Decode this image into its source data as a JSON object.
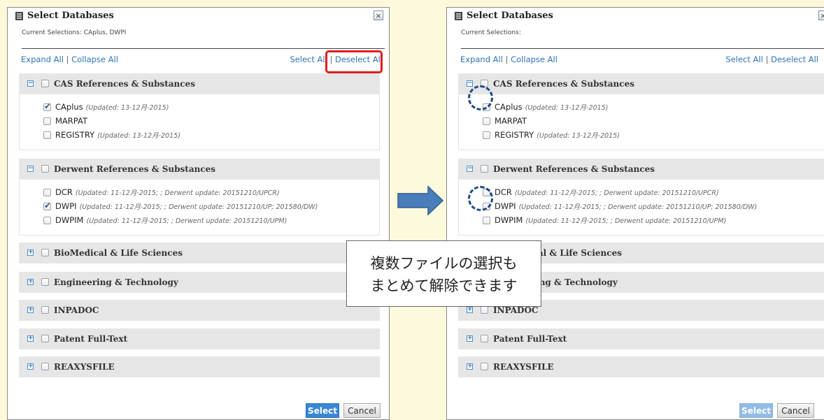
{
  "dialog": {
    "title": "Select Databases",
    "close_label": "×",
    "expand_all": "Expand All",
    "collapse_all": "Collapse All",
    "separator": "|",
    "select_all": "Select All",
    "deselect_all": "Deselect All",
    "select_button": "Select",
    "cancel_button": "Cancel"
  },
  "left": {
    "current_selections": "Current Selections: CAplus, DWPI",
    "sections": [
      {
        "toggle": "−",
        "label": "CAS References & Substances"
      },
      {
        "toggle": "−",
        "label": "Derwent References & Substances"
      },
      {
        "toggle": "+",
        "label": "BioMedical & Life Sciences"
      },
      {
        "toggle": "+",
        "label": "Engineering & Technology"
      },
      {
        "toggle": "+",
        "label": "INPADOC"
      },
      {
        "toggle": "+",
        "label": "Patent Full-Text"
      },
      {
        "toggle": "+",
        "label": "REAXYSFILE"
      }
    ],
    "cas_items": [
      {
        "name": "CAplus",
        "note": "(Updated: 13-12月-2015)",
        "checked": true
      },
      {
        "name": "MARPAT",
        "note": "",
        "checked": false
      },
      {
        "name": "REGISTRY",
        "note": "(Updated: 13-12月-2015)",
        "checked": false
      }
    ],
    "derwent_items": [
      {
        "name": "DCR",
        "note": "(Updated: 11-12月-2015; ; Derwent update: 20151210/UPCR)",
        "checked": false
      },
      {
        "name": "DWPI",
        "note": "(Updated: 11-12月-2015; ; Derwent update: 20151210/UP; 201580/DW)",
        "checked": true
      },
      {
        "name": "DWPIM",
        "note": "(Updated: 11-12月-2015; ; Derwent update: 20151210/UPM)",
        "checked": false
      }
    ]
  },
  "right": {
    "current_selections": "Current Selections:",
    "sections": [
      {
        "toggle": "−",
        "label": "CAS References & Substances"
      },
      {
        "toggle": "−",
        "label": "Derwent References & Substances"
      },
      {
        "toggle": "+",
        "label": "BioMedical & Life Sciences"
      },
      {
        "toggle": "+",
        "label": "Engineering & Technology"
      },
      {
        "toggle": "+",
        "label": "INPADOC"
      },
      {
        "toggle": "+",
        "label": "Patent Full-Text"
      },
      {
        "toggle": "+",
        "label": "REAXYSFILE"
      }
    ],
    "cas_items": [
      {
        "name": "CAplus",
        "note": "(Updated: 13-12月-2015)",
        "checked": false
      },
      {
        "name": "MARPAT",
        "note": "",
        "checked": false
      },
      {
        "name": "REGISTRY",
        "note": "(Updated: 13-12月-2015)",
        "checked": false
      }
    ],
    "derwent_items": [
      {
        "name": "DCR",
        "note": "(Updated: 11-12月-2015; ; Derwent update: 20151210/UPCR)",
        "checked": false
      },
      {
        "name": "DWPI",
        "note": "(Updated: 11-12月-2015; ; Derwent update: 20151210/UP; 201580/DW)",
        "checked": false
      },
      {
        "name": "DWPIM",
        "note": "(Updated: 11-12月-2015; ; Derwent update: 20151210/UPM)",
        "checked": false
      }
    ]
  },
  "callout": {
    "line1": "複数ファイルの選択も",
    "line2": "まとめて解除できます"
  },
  "colors": {
    "background": "#fdf9dc",
    "link": "#2e74b5",
    "highlight": "#e31b1b",
    "arrow": "#4a7ebb",
    "dashed_circle": "#1d4a86",
    "select_button": "#3a87d6"
  },
  "icons": {
    "title": "database-icon",
    "close": "close-icon",
    "check": "checkmark-icon",
    "arrow": "right-arrow-icon"
  }
}
